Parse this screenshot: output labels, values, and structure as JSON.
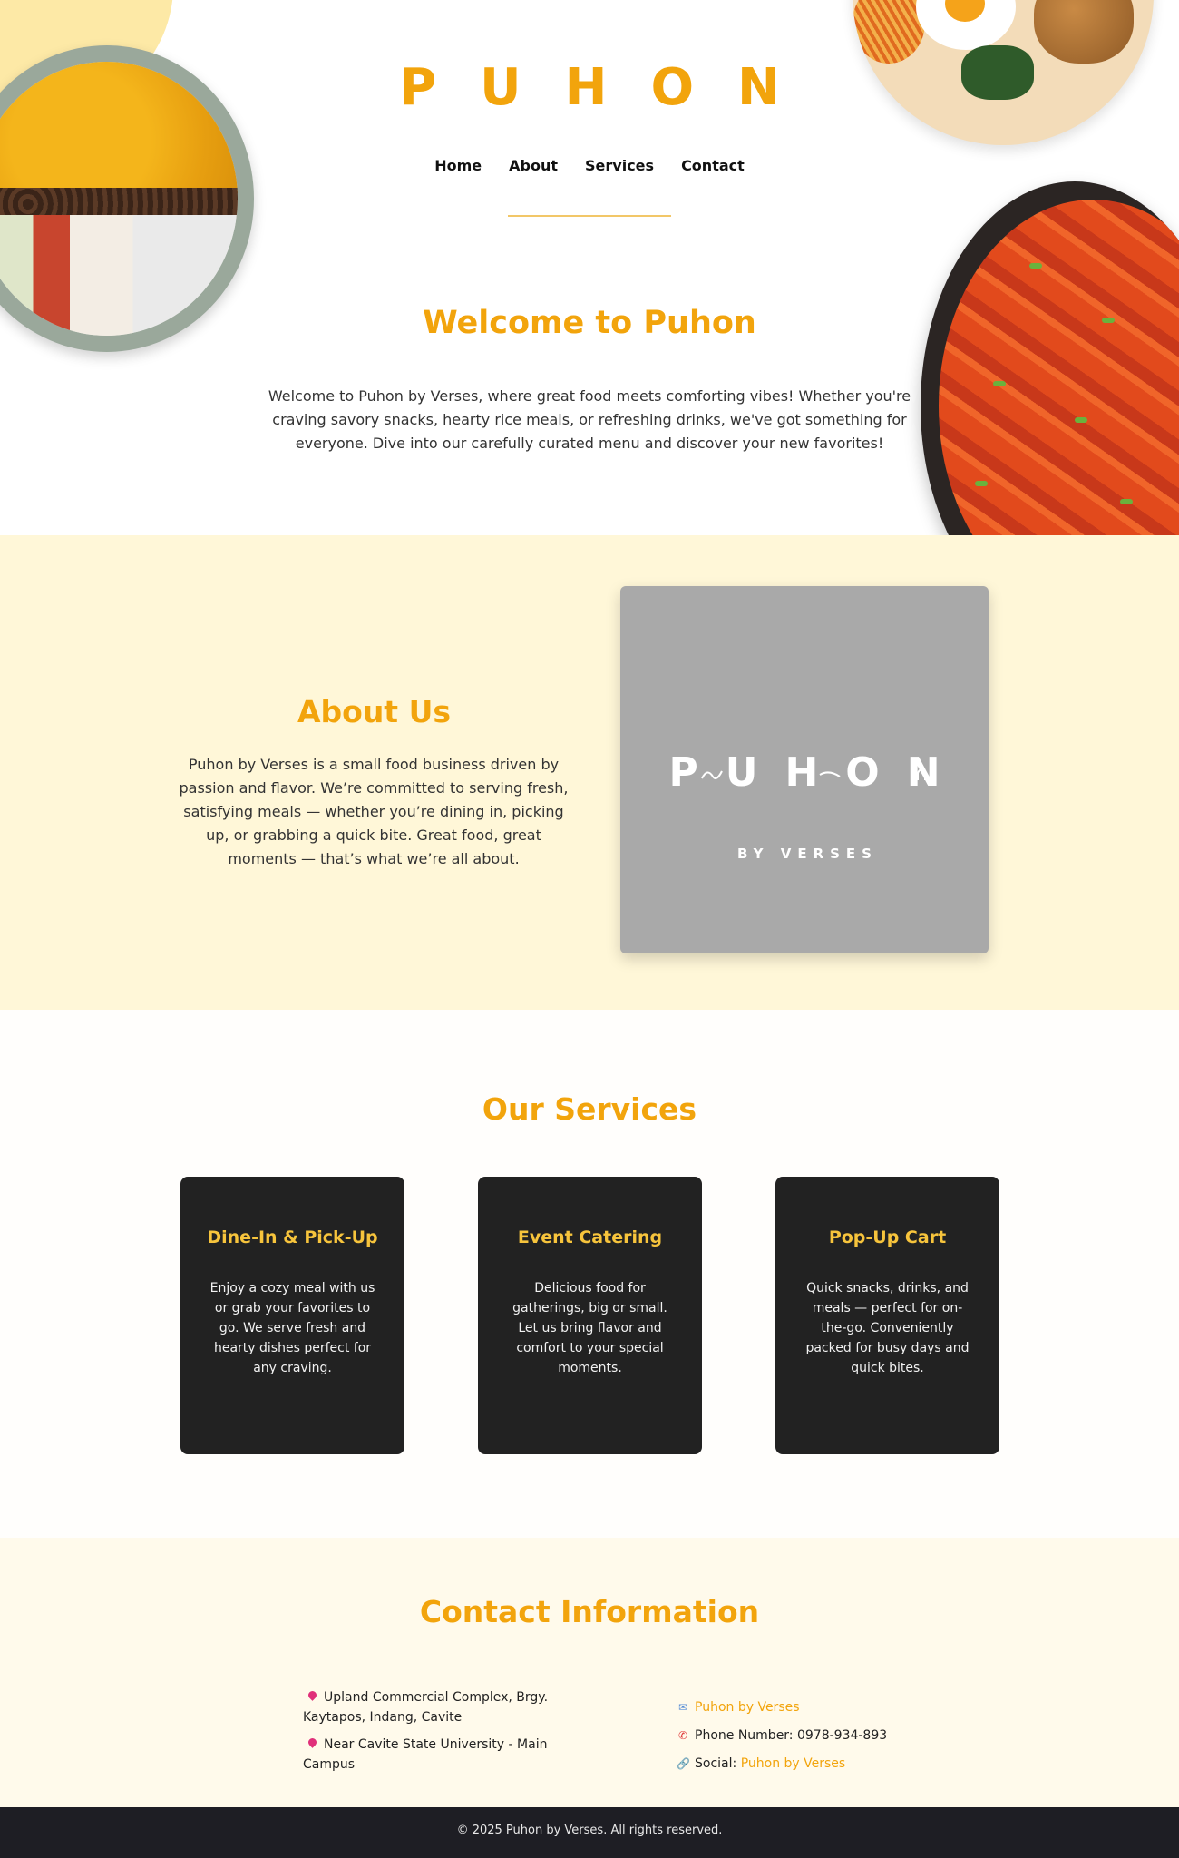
{
  "brand": {
    "title": "PUHON"
  },
  "nav": {
    "items": [
      "Home",
      "About",
      "Services",
      "Contact"
    ]
  },
  "hero": {
    "heading": "Welcome to Puhon",
    "text": "Welcome to Puhon by Verses, where great food meets comforting vibes! Whether you're craving savory snacks, hearty rice meals, or refreshing drinks, we've got something for everyone. Dive into our carefully curated menu and discover your new favorites!"
  },
  "about": {
    "heading": "About Us",
    "text": "Puhon by Verses is a small food business driven by passion and flavor. We’re committed to serving fresh, satisfying meals — whether you’re dining in, picking up, or grabbing a quick bite. Great food, great moments — that’s what we’re all about.",
    "logo_text": "PUHON",
    "logo_sub": "BY VERSES"
  },
  "services": {
    "heading": "Our Services",
    "cards": [
      {
        "title": "Dine-In & Pick-Up",
        "text": "Enjoy a cozy meal with us or grab your favorites to go. We serve fresh and hearty dishes perfect for any craving."
      },
      {
        "title": "Event Catering",
        "text": "Delicious food for gatherings, big or small. Let us bring flavor and comfort to your special moments."
      },
      {
        "title": "Pop-Up Cart",
        "text": "Quick snacks, drinks, and meals — perfect for on-the-go. Conveniently packed for busy days and quick bites."
      }
    ]
  },
  "contact": {
    "heading": "Contact Information",
    "address_1": "Upland Commercial Complex, Brgy. Kaytapos, Indang, Cavite",
    "address_2": "Near Cavite State University - Main Campus",
    "facebook": "Puhon by Verses",
    "phone_label": "Phone Number: 0978-934-893",
    "social_label": "Social:",
    "social_link": "Puhon by Verses"
  },
  "footer": {
    "text": "© 2025 Puhon by Verses. All rights reserved."
  },
  "colors": {
    "accent": "#f2a40c",
    "about_bg": "#fff7d8",
    "card_bg": "#222222",
    "card_title": "#f7c43c",
    "footer_bg": "#1e1e24"
  },
  "icons": {
    "address": "pin-icon",
    "facebook": "facebook-icon",
    "phone": "phone-icon",
    "social": "link-icon"
  }
}
